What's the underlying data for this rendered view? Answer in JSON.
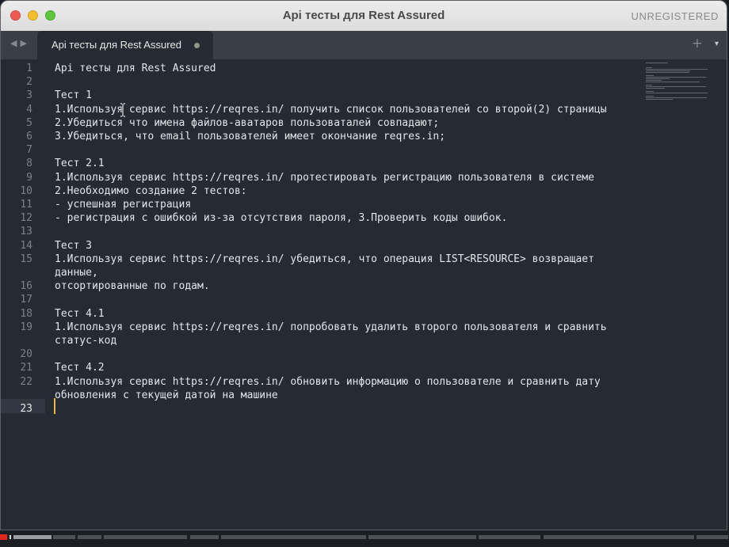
{
  "window": {
    "title": "Api тесты для Rest Assured",
    "registration_status": "UNREGISTERED"
  },
  "tabbar": {
    "nav_back_icon": "chevron-left-icon",
    "nav_forward_icon": "chevron-right-icon",
    "active_tab": {
      "label": "Api тесты для Rest Assured",
      "modified": true
    },
    "new_tab_glyph": "+",
    "menu_glyph": "▾"
  },
  "editor": {
    "current_line": 23,
    "lines": [
      {
        "n": "1",
        "text": "Api тесты для Rest Assured"
      },
      {
        "n": "2",
        "text": ""
      },
      {
        "n": "3",
        "text": "Тест 1"
      },
      {
        "n": "4",
        "text": "1.Используя сервис https://reqres.in/ получить список пользователей со второй(2) страницы"
      },
      {
        "n": "5",
        "text": "2.Убедиться что имена файлов-аватаров пользоваталей совпадают;"
      },
      {
        "n": "6",
        "text": "3.Убедиться, что email пользователей имеет окончание reqres.in;"
      },
      {
        "n": "7",
        "text": ""
      },
      {
        "n": "8",
        "text": "Тест 2.1"
      },
      {
        "n": "9",
        "text": "1.Используя сервис https://reqres.in/ протестировать регистрацию пользователя в системе"
      },
      {
        "n": "10",
        "text": "2.Необходимо создание 2 тестов:"
      },
      {
        "n": "11",
        "text": "- успешная регистрация"
      },
      {
        "n": "12",
        "text": "- регистрация с ошибкой из-за отсутствия пароля, 3.Проверить коды ошибок."
      },
      {
        "n": "13",
        "text": ""
      },
      {
        "n": "14",
        "text": "Тест 3"
      },
      {
        "n": "15",
        "text": "1.Используя сервис https://reqres.in/ убедиться, что операция LIST<RESOURCE> возвращает"
      },
      {
        "n": "",
        "text": "данные,"
      },
      {
        "n": "16",
        "text": "отсортированные по годам."
      },
      {
        "n": "17",
        "text": ""
      },
      {
        "n": "18",
        "text": "Тест 4.1"
      },
      {
        "n": "19",
        "text": "1.Используя сервис https://reqres.in/ попробовать удалить второго пользователя и сравнить"
      },
      {
        "n": "",
        "text": "статус-код"
      },
      {
        "n": "20",
        "text": ""
      },
      {
        "n": "21",
        "text": "Тест 4.2"
      },
      {
        "n": "22",
        "text": "1.Используя сервис https://reqres.in/ обновить информацию о пользователе и сравнить дату"
      },
      {
        "n": "",
        "text": "обновления с текущей датой на машине"
      },
      {
        "n": "23",
        "text": ""
      }
    ]
  },
  "colors": {
    "editor_background": "#262b33",
    "text": "#e3e6ea",
    "gutter_text": "#7b808a",
    "caret": "#e5b84a",
    "close_button": "#ee5a52",
    "minimize_button": "#f5bd30",
    "maximize_button": "#5fc53f"
  }
}
